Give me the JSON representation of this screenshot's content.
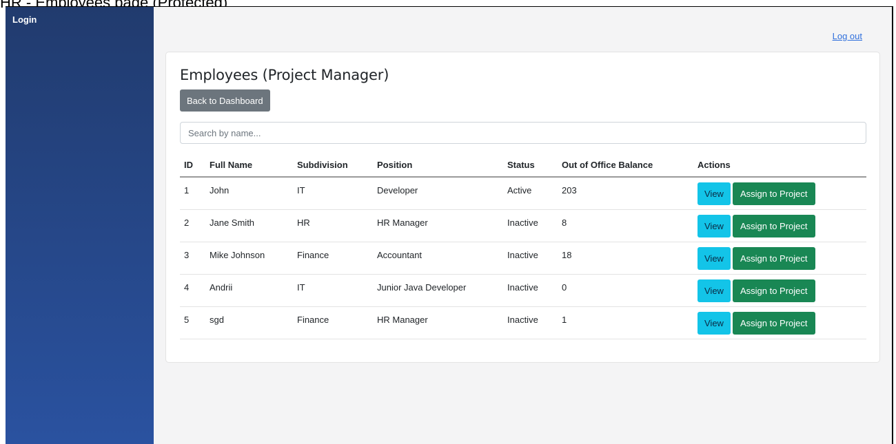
{
  "caption": "HR - Employees page (Protected)",
  "sidebar": {
    "title": "Login"
  },
  "header": {
    "logout_label": "Log out"
  },
  "page": {
    "title": "Employees (Project Manager)",
    "back_button_label": "Back to Dashboard"
  },
  "search": {
    "placeholder": "Search by name..."
  },
  "table": {
    "columns": [
      "ID",
      "Full Name",
      "Subdivision",
      "Position",
      "Status",
      "Out of Office Balance",
      "Actions"
    ],
    "rows": [
      {
        "id": "1",
        "full_name": "John",
        "subdivision": "IT",
        "position": "Developer",
        "status": "Active",
        "balance": "203",
        "view_label": "View",
        "assign_label": "Assign to Project"
      },
      {
        "id": "2",
        "full_name": "Jane Smith",
        "subdivision": "HR",
        "position": "HR Manager",
        "status": "Inactive",
        "balance": "8",
        "view_label": "View",
        "assign_label": "Assign to Project"
      },
      {
        "id": "3",
        "full_name": "Mike Johnson",
        "subdivision": "Finance",
        "position": "Accountant",
        "status": "Inactive",
        "balance": "18",
        "view_label": "View",
        "assign_label": "Assign to Project"
      },
      {
        "id": "4",
        "full_name": "Andrii",
        "subdivision": "IT",
        "position": "Junior Java Developer",
        "status": "Inactive",
        "balance": "0",
        "view_label": "View",
        "assign_label": "Assign to Project"
      },
      {
        "id": "5",
        "full_name": "sgd",
        "subdivision": "Finance",
        "position": "HR Manager",
        "status": "Inactive",
        "balance": "1",
        "view_label": "View",
        "assign_label": "Assign to Project"
      }
    ]
  },
  "colors": {
    "sidebar_top": "#213b6e",
    "sidebar_bottom": "#2a52a0",
    "view_button": "#13c4e8",
    "assign_button": "#198754",
    "back_button": "#6c757d",
    "link": "#2f6fdc"
  }
}
